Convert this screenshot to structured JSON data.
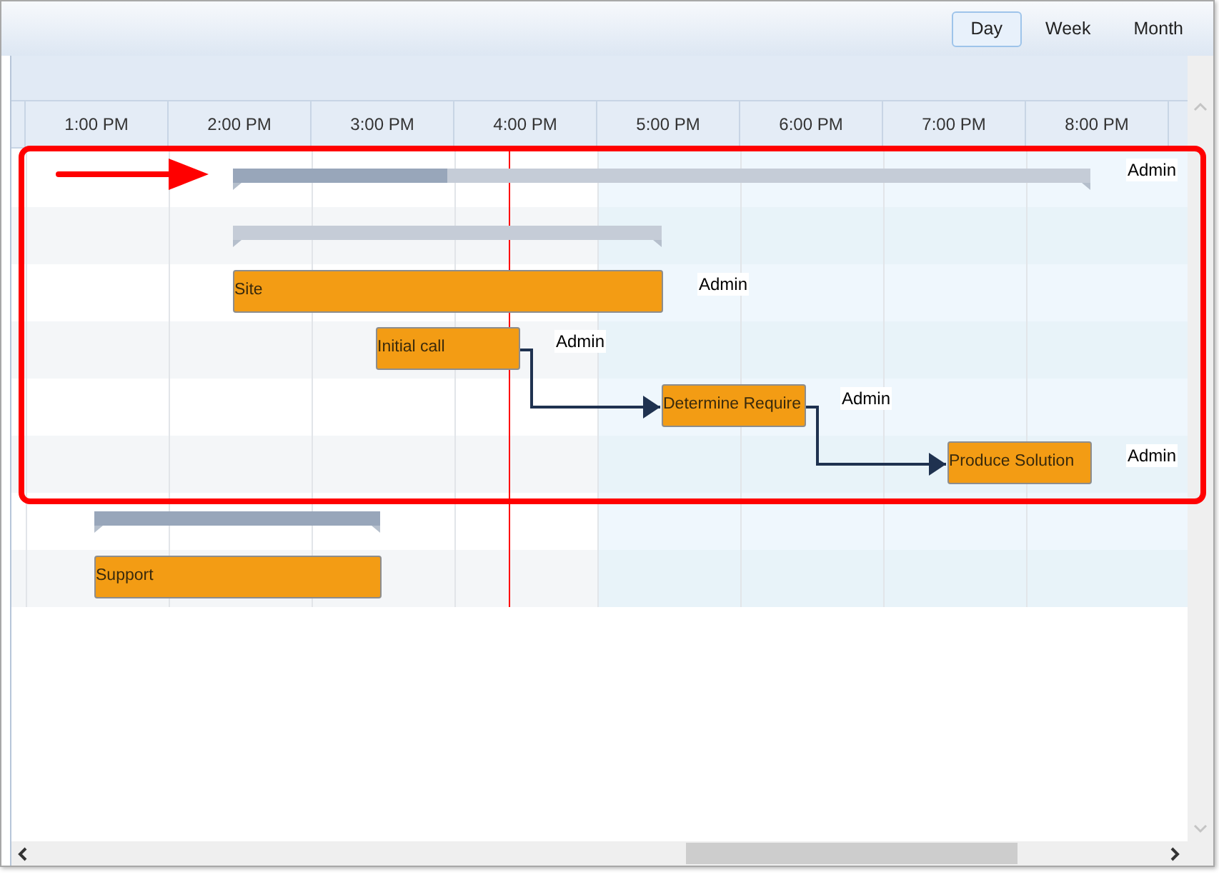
{
  "toolbar": {
    "views": [
      {
        "label": "Day",
        "selected": true
      },
      {
        "label": "Week",
        "selected": false
      },
      {
        "label": "Month",
        "selected": false
      }
    ]
  },
  "timescale": {
    "hours": [
      "1:00 PM",
      "2:00 PM",
      "3:00 PM",
      "4:00 PM",
      "5:00 PM",
      "6:00 PM",
      "7:00 PM",
      "8:00 PM"
    ]
  },
  "rows": [
    {
      "kind": "summary",
      "level": 0.25,
      "resource": "Admin"
    },
    {
      "kind": "summary"
    },
    {
      "kind": "task",
      "label": "Site",
      "resource": "Admin"
    },
    {
      "kind": "task",
      "label": "Initial call",
      "resource": "Admin"
    },
    {
      "kind": "task",
      "label": "Determine Require",
      "resource": "Admin"
    },
    {
      "kind": "task",
      "label": "Produce Solution",
      "resource": "Admin"
    },
    {
      "kind": "summary",
      "level": 1
    },
    {
      "kind": "task",
      "label": "Support"
    }
  ]
}
